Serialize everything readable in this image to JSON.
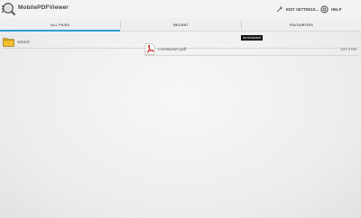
{
  "app": {
    "title": "MobilePDFViewer"
  },
  "actions": {
    "edit_settings": "EDIT SETTINGS...",
    "help": "HELP"
  },
  "tabs": [
    {
      "label": "ALL FILES",
      "selected": true
    },
    {
      "label": "RECENT",
      "selected": false
    },
    {
      "label": "FAVOURITES",
      "selected": false
    }
  ],
  "folder": {
    "name": "sdcard",
    "icon": "folder-icon"
  },
  "tooltip": "/mnt/sdcard",
  "files": [
    {
      "name": "LoremIpsum.pdf",
      "size": "127.2 KB",
      "icon": "pdf-icon"
    }
  ],
  "colors": {
    "accent": "#2a9fd6",
    "folder": "#f2c12e",
    "pdf_red": "#c8281e"
  }
}
